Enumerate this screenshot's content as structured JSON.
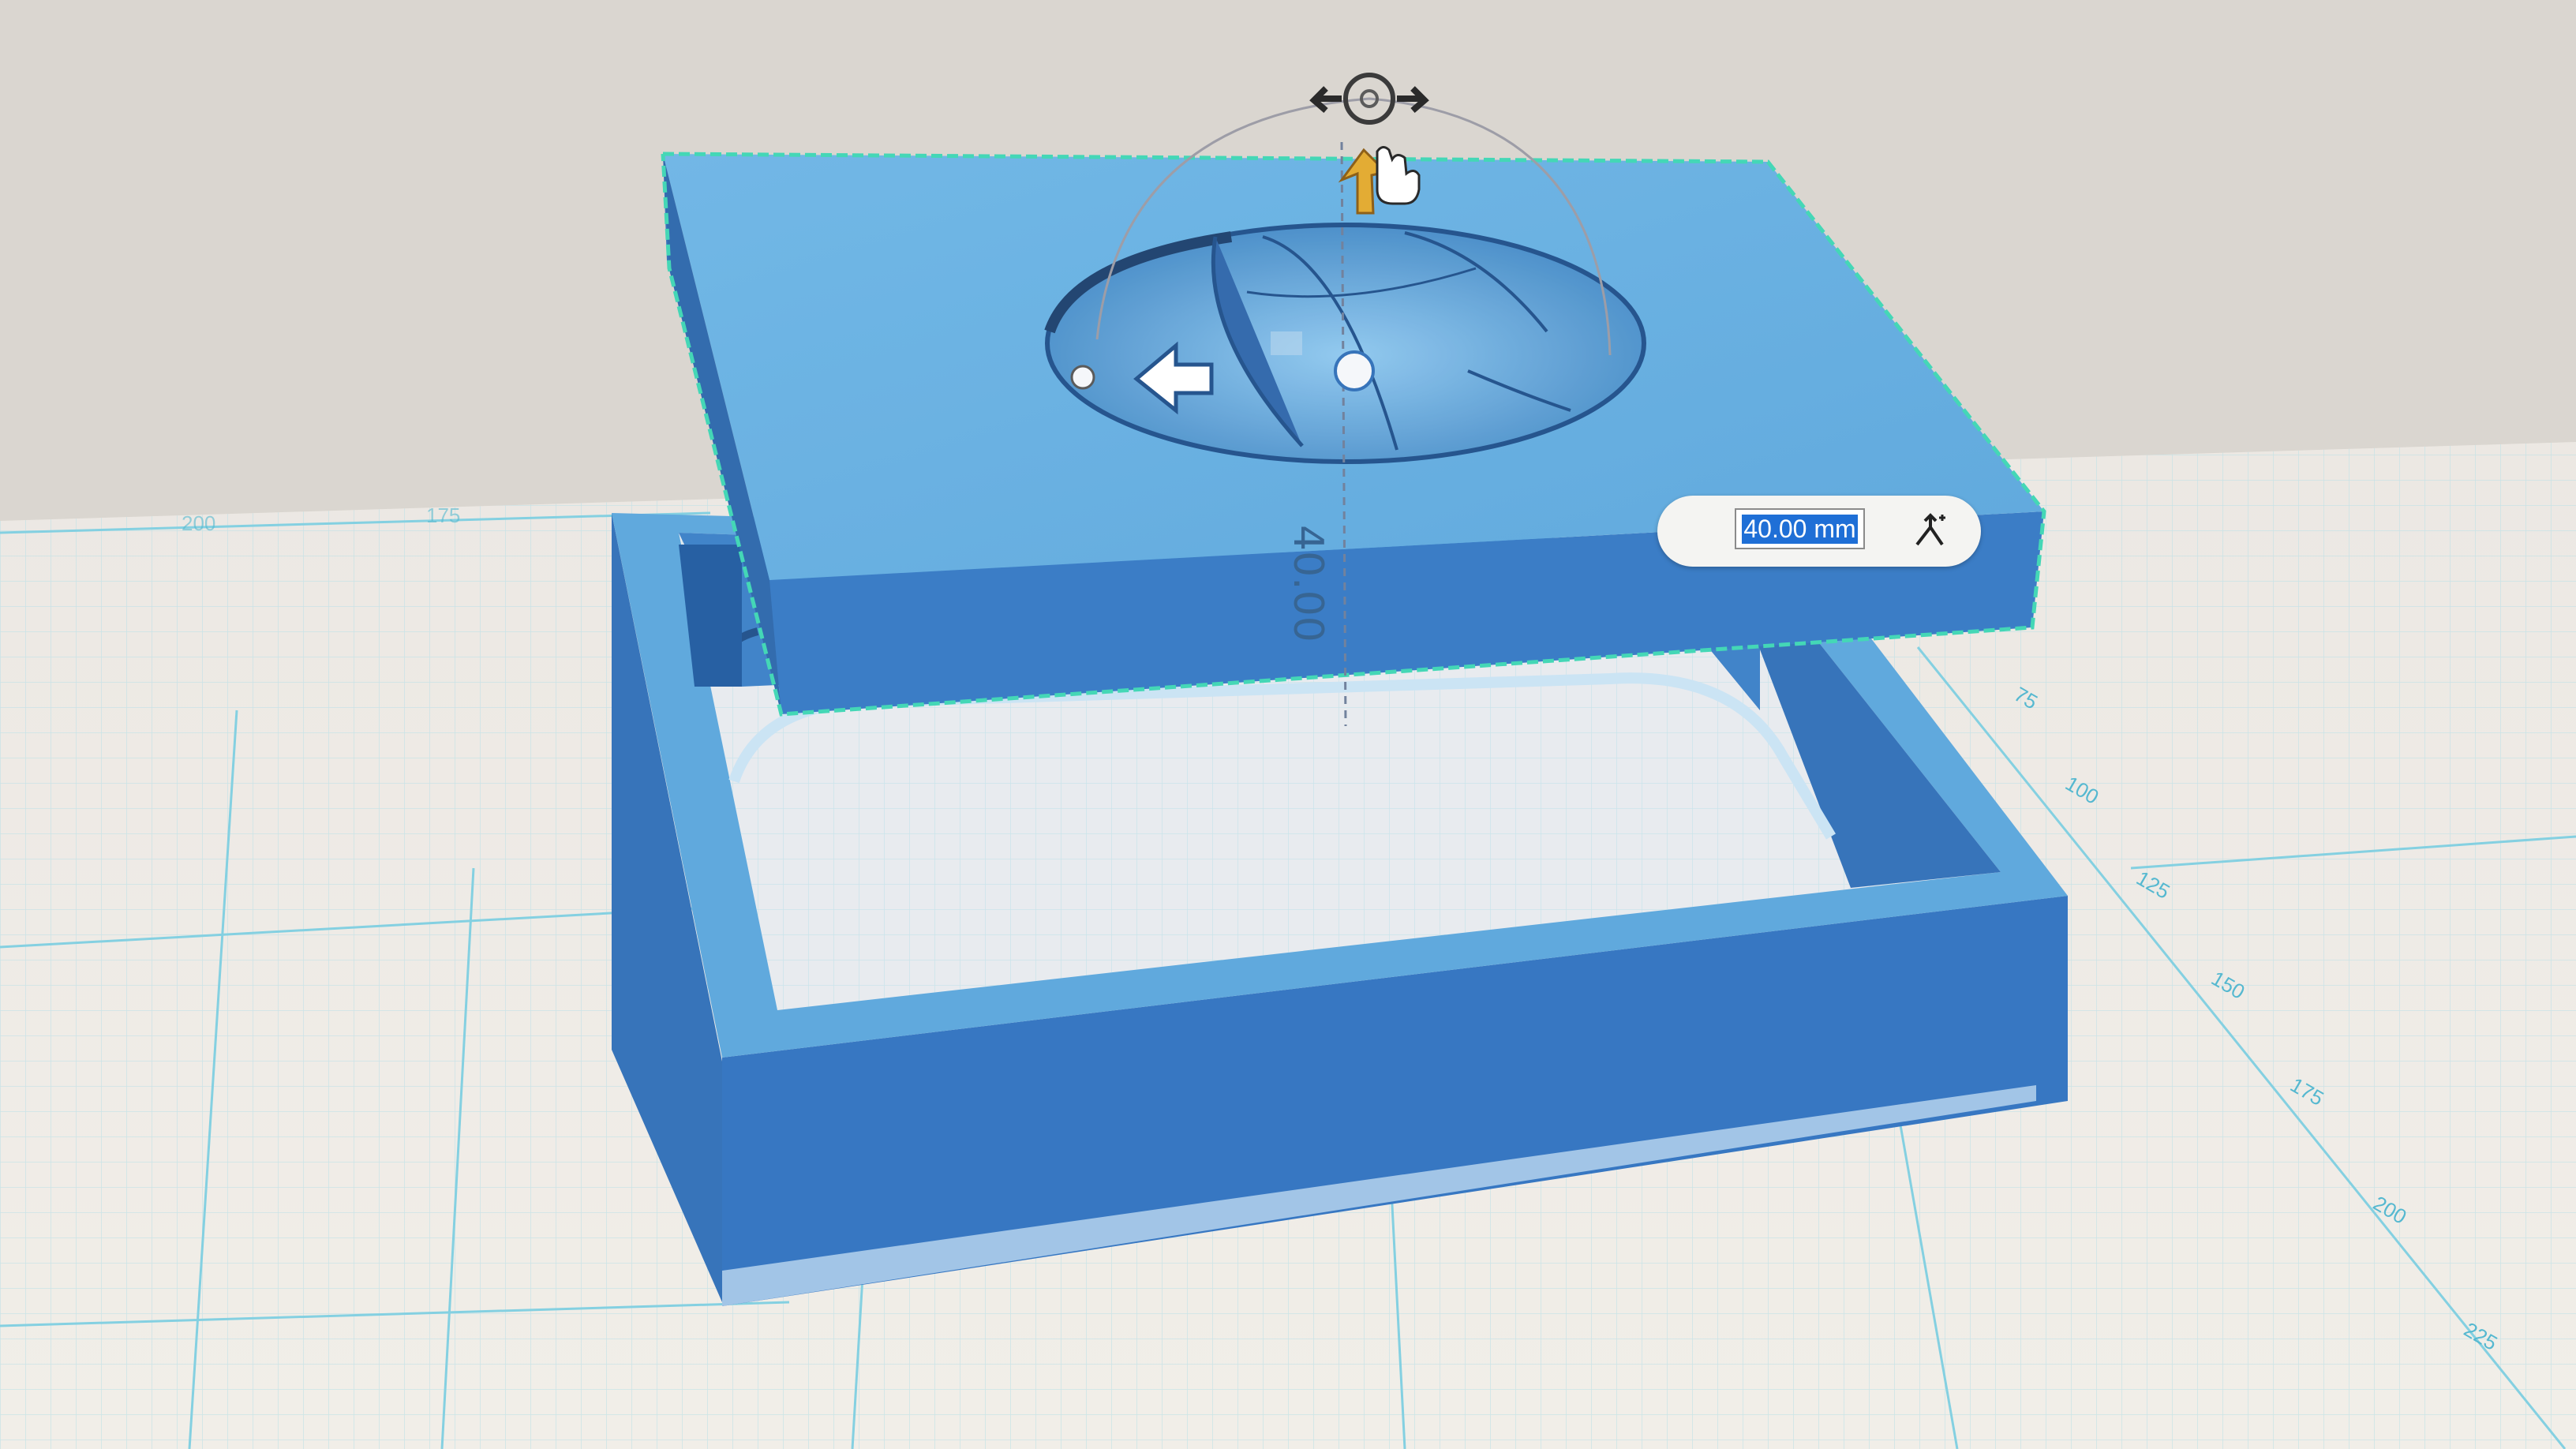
{
  "viewport": {
    "grid_axis_labels": [
      "75",
      "100",
      "125",
      "150",
      "175",
      "200",
      "225"
    ],
    "grid_faded_labels": [
      "200",
      "175"
    ]
  },
  "move_gizmo": {
    "dimension_readout": "40.00"
  },
  "dimension_input": {
    "value": "40.00 mm"
  },
  "icons": {
    "rotate_handle": "rotate-arrows-icon",
    "move_up_arrow": "arrow-up-icon",
    "cursor": "hand-pointer-icon",
    "move_arrow": "arrow-left-icon",
    "snap_button": "snap-to-icon"
  },
  "colors": {
    "model_blue": "#3e8fd0",
    "selection_outline": "#3dd6b4",
    "grid_line": "#7fcfe0",
    "move_arrow": "#e2a92c"
  }
}
